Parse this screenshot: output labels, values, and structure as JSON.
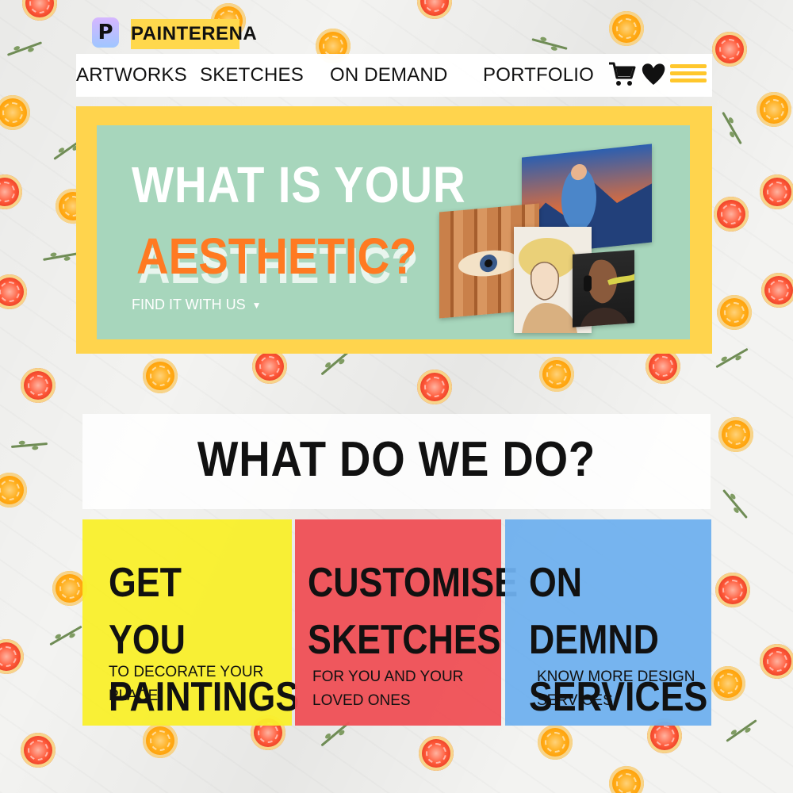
{
  "brand": {
    "logo_glyph": "P",
    "name": "PAINTERENA",
    "accent_color": "#ffd84d"
  },
  "nav": {
    "items": [
      {
        "label": "ARTWORKS"
      },
      {
        "label": "SKETCHES"
      },
      {
        "label": "ON DEMAND"
      },
      {
        "label": "PORTFOLIO"
      }
    ],
    "icons": [
      "cart-icon",
      "heart-icon",
      "hamburger-menu-icon"
    ]
  },
  "hero": {
    "title_line1": "WHAT IS YOUR",
    "title_line2": "AESTHETIC?",
    "cta": "FIND IT WITH US",
    "frame_color": "#ffd44d",
    "panel_color": "#a0d6c6",
    "accent_color": "#ff7a22"
  },
  "section": {
    "title": "WHAT DO WE DO?"
  },
  "services": [
    {
      "title_line1": "GET YOU",
      "title_line2": "PAINTINGS",
      "desc_line1": "TO DECORATE YOUR",
      "desc_line2": "PLACE",
      "color": "#f9ef2b"
    },
    {
      "title_line1": "CUSTOMISE",
      "title_line2": "SKETCHES",
      "desc_line1": "FOR YOU AND YOUR",
      "desc_line2": "LOVED ONES",
      "color": "#ef4f55"
    },
    {
      "title_line1": "ON DEMND",
      "title_line2": "SERVICES",
      "desc_line1": "KNOW MORE DESIGN",
      "desc_line2": "SERVICES",
      "color": "#6fb0ee"
    }
  ]
}
